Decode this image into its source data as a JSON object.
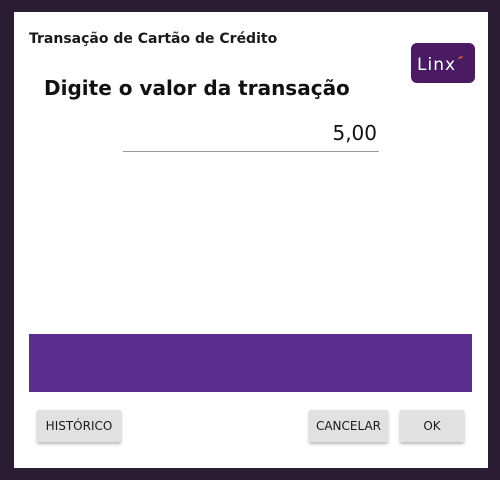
{
  "dialog": {
    "title": "Transação de Cartão de Crédito",
    "prompt": "Digite o valor da transação",
    "amount_value": "5,00",
    "logo": {
      "text": "Linx",
      "icon": "linx-logo-icon",
      "background": "#4a1a63",
      "accent": "#f26a2e"
    },
    "status_bar_color": "#5b2d8e"
  },
  "buttons": {
    "history_label": "HISTÓRICO",
    "cancel_label": "CANCELAR",
    "ok_label": "OK"
  }
}
